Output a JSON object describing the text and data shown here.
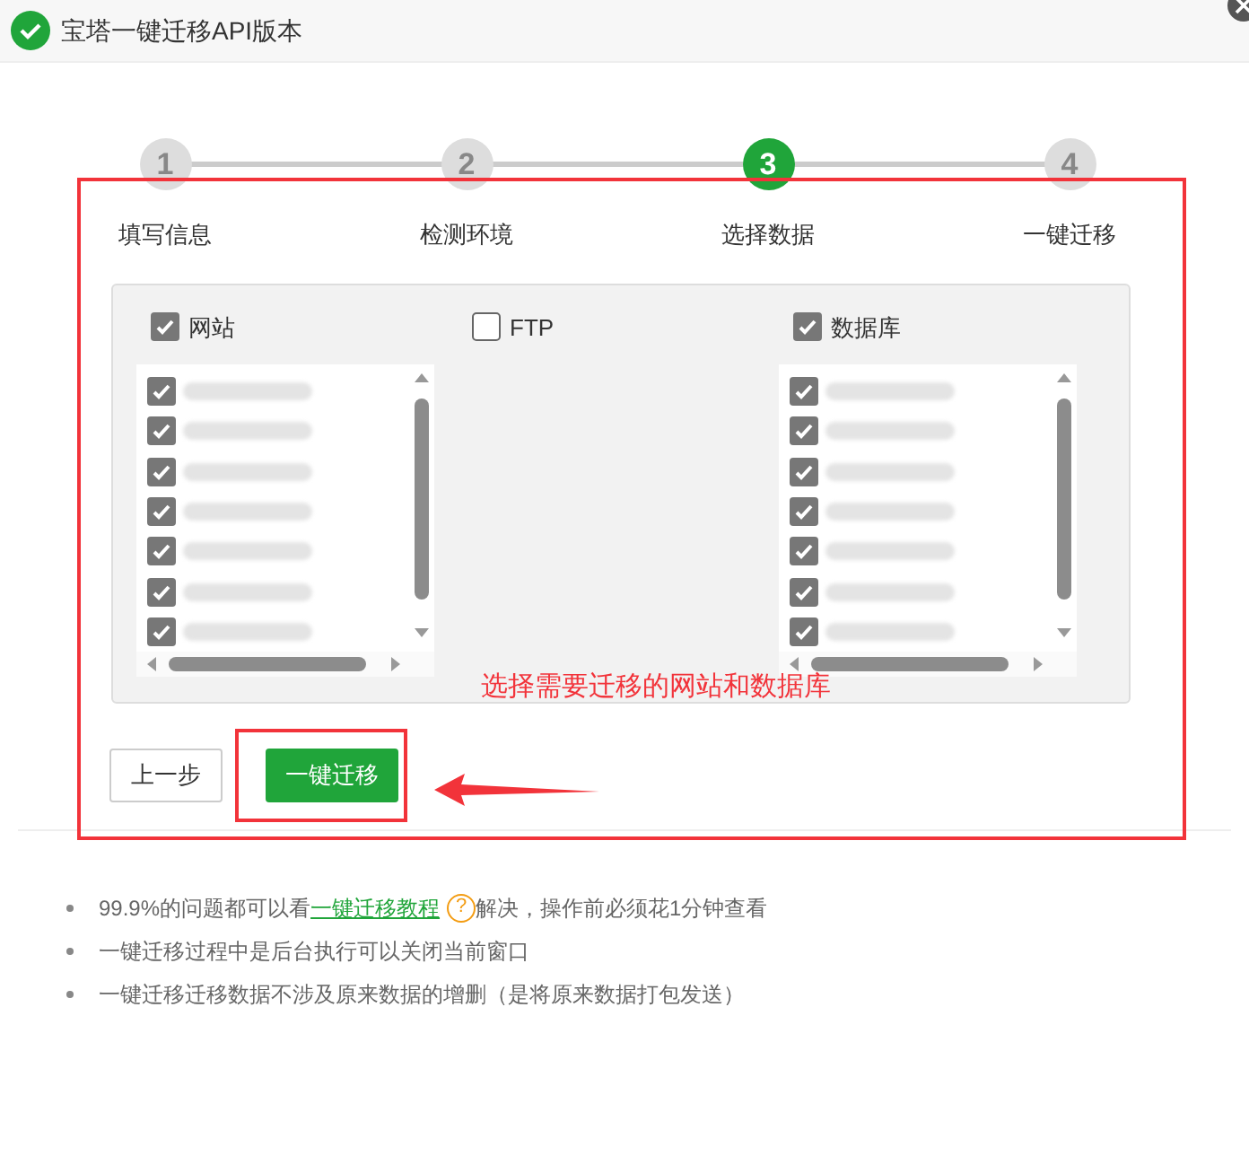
{
  "window": {
    "title": "宝塔一键迁移API版本"
  },
  "steps": [
    {
      "number": "1",
      "label": "填写信息",
      "selected": false
    },
    {
      "number": "2",
      "label": "检测环境",
      "selected": false
    },
    {
      "number": "3",
      "label": "选择数据",
      "selected": true
    },
    {
      "number": "4",
      "label": "一键迁移",
      "selected": false
    }
  ],
  "groups": [
    {
      "label": "网站",
      "checked": true,
      "items": [
        {
          "checked": true
        },
        {
          "checked": true
        },
        {
          "checked": true
        },
        {
          "checked": true
        },
        {
          "checked": true
        },
        {
          "checked": true
        },
        {
          "checked": true
        }
      ]
    },
    {
      "label": "FTP",
      "checked": false
    },
    {
      "label": "数据库",
      "checked": true,
      "items": [
        {
          "checked": true
        },
        {
          "checked": true
        },
        {
          "checked": true
        },
        {
          "checked": true
        },
        {
          "checked": true
        },
        {
          "checked": true
        },
        {
          "checked": true
        }
      ]
    }
  ],
  "annotation": "选择需要迁移的网站和数据库",
  "buttons": [
    {
      "label": "上一步",
      "kind": "secondary"
    },
    {
      "label": "一键迁移",
      "kind": "primary"
    }
  ],
  "notes": [
    {
      "before": "99.9%的问题都可以看",
      "link": "一键迁移教程",
      "help": "?",
      "after": "解决，操作前必须花1分钟查看"
    },
    {
      "before": "一键迁移过程中是后台执行可以关闭当前窗口"
    },
    {
      "before": "一键迁移迁移数据不涉及原来数据的增删（是将原来数据打包发送）"
    }
  ]
}
